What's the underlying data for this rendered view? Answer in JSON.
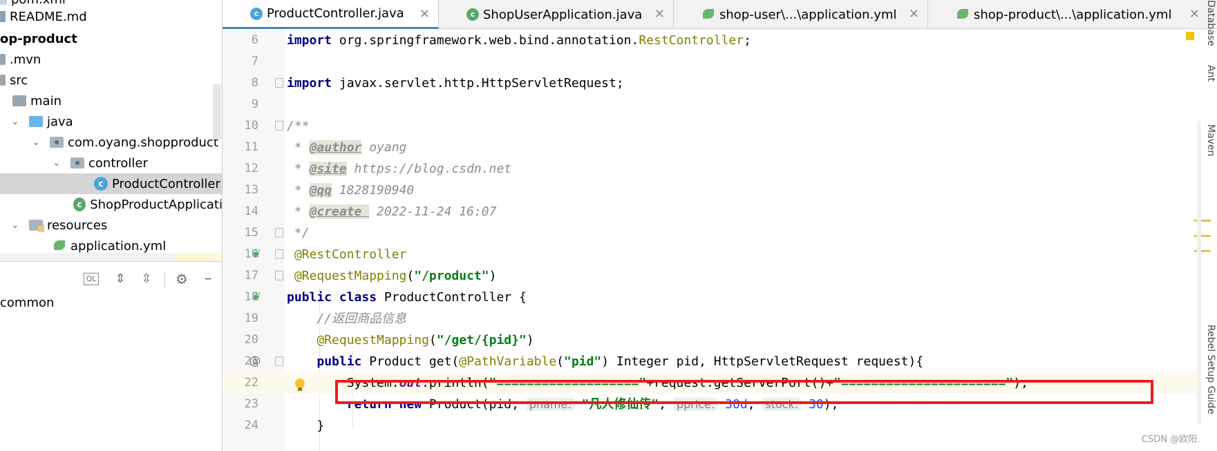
{
  "project_tree": [
    {
      "label": "pom.xml",
      "icon": "xml-file-icon",
      "indent": 0
    },
    {
      "label": "README.md",
      "icon": "markdown-file-icon",
      "indent": 0
    },
    {
      "label": "op-product",
      "icon": "module-icon",
      "indent": 0,
      "bold": true
    },
    {
      "label": ".mvn",
      "icon": "folder-icon",
      "indent": 0
    },
    {
      "label": "src",
      "icon": "folder-icon",
      "indent": 0
    },
    {
      "label": "main",
      "icon": "folder-icon",
      "indent": 1
    },
    {
      "label": "java",
      "icon": "source-folder-icon",
      "indent": 1
    },
    {
      "label": "com.oyang.shopproduct",
      "icon": "package-icon",
      "indent": 2
    },
    {
      "label": "controller",
      "icon": "package-icon",
      "indent": 3
    },
    {
      "label": "ProductController",
      "icon": "class-icon",
      "indent": 4,
      "selected": true
    },
    {
      "label": "ShopProductApplicati",
      "icon": "spring-class-icon",
      "indent": 3
    },
    {
      "label": "resources",
      "icon": "resources-folder-icon",
      "indent": 1
    },
    {
      "label": "application.yml",
      "icon": "yaml-leaf-icon",
      "indent": 2
    }
  ],
  "lower_panel": {
    "common_label": "common"
  },
  "tabs": [
    {
      "label": "ProductController.java",
      "icon": "class-icon",
      "active": true
    },
    {
      "label": "ShopUserApplication.java",
      "icon": "spring-class-icon",
      "active": false
    },
    {
      "label": "shop-user\\...\\application.yml",
      "icon": "yaml-leaf-icon",
      "active": false
    },
    {
      "label": "shop-product\\...\\application.yml",
      "icon": "yaml-leaf-icon",
      "active": false
    }
  ],
  "code": {
    "line_numbers": [
      "6",
      "7",
      "8",
      "9",
      "10",
      "11",
      "12",
      "13",
      "14",
      "15",
      "16",
      "17",
      "18",
      "19",
      "20",
      "21",
      "22",
      "23",
      "24"
    ],
    "l6": {
      "kw": "import",
      "path": " org.springframework.web.bind.annotation.",
      "ann": "RestController",
      "end": ";"
    },
    "l8": {
      "kw": "import",
      "rest": " javax.servlet.http.HttpServletRequest;"
    },
    "l10": "/**",
    "l11": {
      "prefix": " * ",
      "tag": "@author",
      "val": " oyang"
    },
    "l12": {
      "prefix": " * ",
      "tag": "@site",
      "val": " https://blog.csdn.net"
    },
    "l13": {
      "prefix": " * ",
      "tag": "@qq",
      "val": " 1828190940"
    },
    "l14": {
      "prefix": " * ",
      "tag": "@create ",
      "val": " 2022-11-24 16:07"
    },
    "l15": " */",
    "l16": " @RestController",
    "l17": {
      "ann": " @RequestMapping",
      "open": "(",
      "str": "\"/product\"",
      "close": ")"
    },
    "l18": {
      "kw1": "public",
      "kw2": "class",
      "rest": " ProductController {"
    },
    "l19": "    //返回商品信息",
    "l20": {
      "ann": "    @RequestMapping",
      "open": "(",
      "str": "\"/get/{pid}\"",
      "close": ")"
    },
    "l21": {
      "indent": "    ",
      "kw": "public",
      "a": " Product get(",
      "ann": "@PathVariable",
      "b": "(",
      "str": "\"pid\"",
      "c": ") Integer pid, HttpServletRequest request){"
    },
    "l22": {
      "indent": "        ",
      "a": "System.",
      "field": "out",
      "b": ".println(",
      "s1": "\"===================\"",
      "c": "+request.getServerPort()+",
      "s2": "\"======================\"",
      "d": ");"
    },
    "l23": {
      "indent": "        ",
      "kw1": "return",
      "kw2": "new",
      "a": " Product(pid, ",
      "h1": "pname:",
      "s1": "\"凡人修仙传\"",
      "b": ", ",
      "h2": "pprice:",
      "n1": "30d",
      "c": ", ",
      "h3": "stock:",
      "n2": "30",
      "d": ");"
    },
    "l24": "    }"
  },
  "right_stripe": {
    "labels": [
      "Database",
      "Ant",
      "Maven",
      "Rebel Setup Guide"
    ]
  },
  "watermark": "CSDN @欧阳."
}
